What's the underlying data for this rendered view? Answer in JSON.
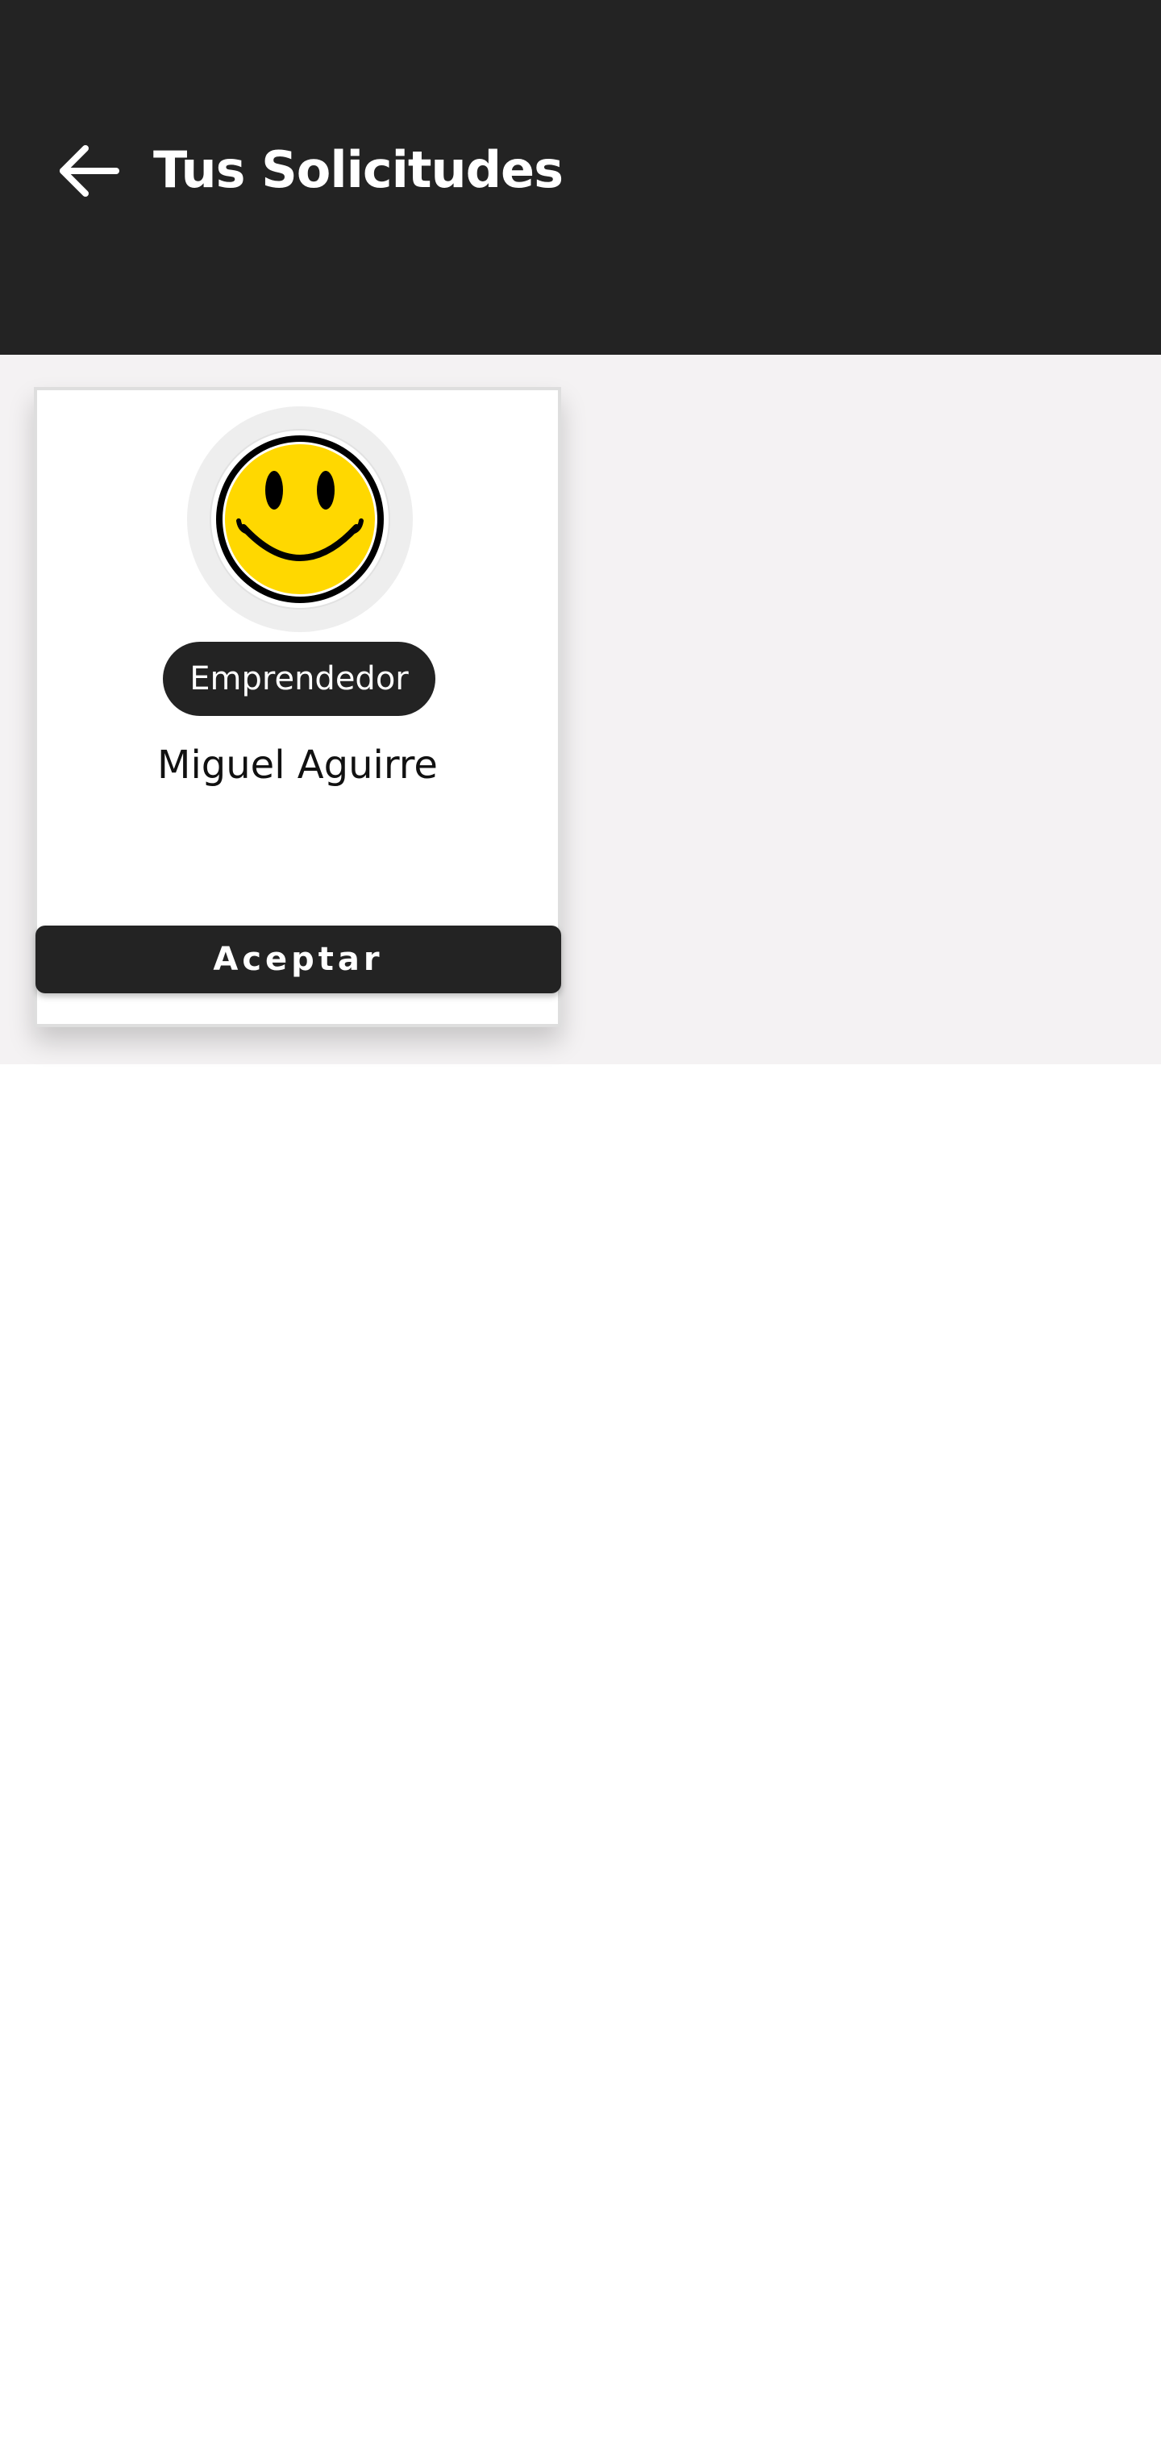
{
  "header": {
    "title": "Tus Solicitudes",
    "back_icon": "arrow-left-icon",
    "background_color": "#232323"
  },
  "requests": [
    {
      "avatar_icon": "smiley-face-icon",
      "role": "Emprendedor",
      "name": "Miguel Aguirre",
      "accept_label": "Aceptar"
    }
  ],
  "colors": {
    "dark": "#232323",
    "content_background": "#f4f2f3",
    "card_background": "#ffffff",
    "smiley_yellow": "#ffd800"
  }
}
